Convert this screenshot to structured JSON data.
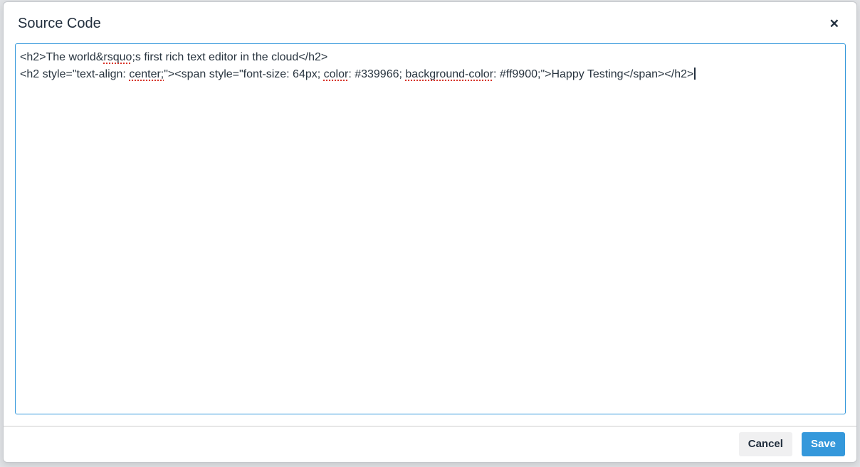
{
  "dialog": {
    "title": "Source Code",
    "close_icon": "✕"
  },
  "editor": {
    "caret_visible": true,
    "lines": [
      {
        "segments": [
          {
            "text": "<h2>The world&",
            "misspelled": false
          },
          {
            "text": "rsquo",
            "misspelled": true
          },
          {
            "text": ";s first rich text editor in the cloud</h2>",
            "misspelled": false
          }
        ]
      },
      {
        "segments": [
          {
            "text": "<h2 style=\"text-align: ",
            "misspelled": false
          },
          {
            "text": "center;",
            "misspelled": true
          },
          {
            "text": "\"><span style=\"font-size: 64px; ",
            "misspelled": false
          },
          {
            "text": "color",
            "misspelled": true
          },
          {
            "text": ": #339966; ",
            "misspelled": false
          },
          {
            "text": "background-color",
            "misspelled": true
          },
          {
            "text": ": #ff9900;\">Happy Testing</span></h2>",
            "misspelled": false
          }
        ]
      }
    ]
  },
  "footer": {
    "cancel_label": "Cancel",
    "save_label": "Save"
  },
  "colors": {
    "accent_blue": "#3498db",
    "save_button_bg": "#3498db",
    "save_button_text": "#ffffff",
    "cancel_button_bg": "#f0f0f1",
    "cancel_button_text": "#222f3e",
    "title_text": "#222f3e",
    "code_text": "#28343f",
    "spellcheck_underline": "#d8352a",
    "editor_focus_border": "#3498db",
    "dialog_border": "#c5c8cc",
    "footer_divider": "#cccccc",
    "backdrop": "#e1e3e6"
  }
}
